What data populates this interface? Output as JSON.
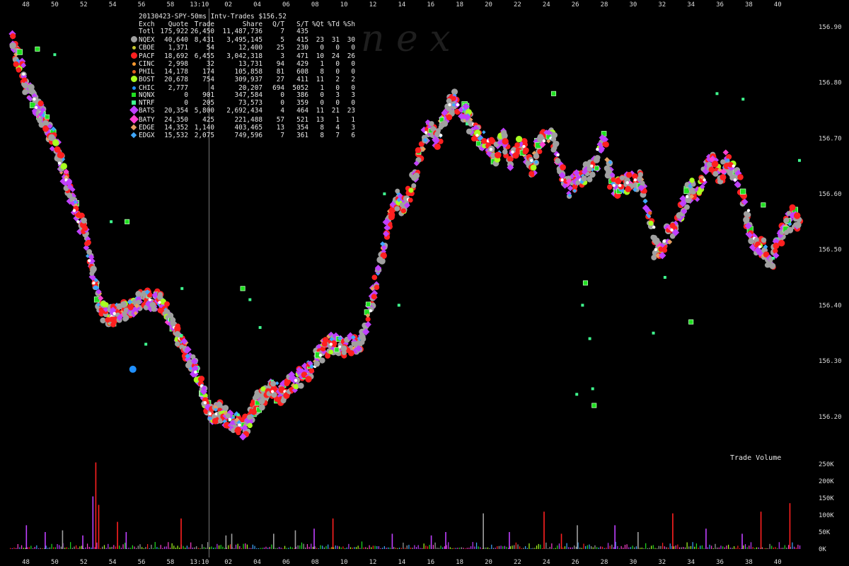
{
  "chart_data": {
    "type": "scatter",
    "title": "20130423-SPY-50ms Intv-Trades $156.52",
    "watermark": "n   e   x",
    "y_ticks": [
      "156.90",
      "156.80",
      "156.70",
      "156.60",
      "156.50",
      "156.40",
      "156.30",
      "156.20"
    ],
    "y_range": [
      156.135,
      156.91
    ],
    "x_ticks_top": [
      "48",
      "50",
      "52",
      "54",
      "56",
      "58",
      "13:10",
      "02",
      "04",
      "06",
      "08",
      "10",
      "12",
      "14",
      "16",
      "18",
      "20",
      "22",
      "24",
      "26",
      "28",
      "30",
      "32",
      "34",
      "36",
      "38",
      "40"
    ],
    "x_ticks_bottom": [
      "48",
      "50",
      "52",
      "54",
      "56",
      "58",
      "13:10",
      "02",
      "04",
      "06",
      "08",
      "10",
      "12",
      "14",
      "16",
      "18",
      "20",
      "22",
      "24",
      "26",
      "28",
      "30",
      "32",
      "34",
      "36",
      "38",
      "40"
    ],
    "x_unit": "minutes (13:00 = 60)",
    "x_range": [
      46.8,
      101.6
    ],
    "grid": "vertical line at 13:10 only",
    "volume_panel": {
      "title": "Trade Volume",
      "y_ticks": [
        "250K",
        "200K",
        "150K",
        "100K",
        "50K",
        "0K"
      ],
      "y_range": [
        0,
        250000
      ]
    },
    "price_path": [
      [
        47.0,
        156.88
      ],
      [
        47.3,
        156.85
      ],
      [
        47.7,
        156.83
      ],
      [
        48.0,
        156.8
      ],
      [
        48.3,
        156.78
      ],
      [
        48.7,
        156.76
      ],
      [
        49.0,
        156.75
      ],
      [
        49.3,
        156.73
      ],
      [
        49.7,
        156.71
      ],
      [
        50.0,
        156.69
      ],
      [
        50.3,
        156.67
      ],
      [
        50.6,
        156.64
      ],
      [
        51.0,
        156.61
      ],
      [
        51.3,
        156.58
      ],
      [
        51.6,
        156.56
      ],
      [
        52.0,
        156.54
      ],
      [
        52.3,
        156.5
      ],
      [
        52.6,
        156.46
      ],
      [
        52.9,
        156.42
      ],
      [
        53.3,
        156.39
      ],
      [
        53.7,
        156.38
      ],
      [
        54.0,
        156.38
      ],
      [
        54.4,
        156.39
      ],
      [
        54.8,
        156.39
      ],
      [
        55.2,
        156.39
      ],
      [
        55.6,
        156.4
      ],
      [
        56.0,
        156.41
      ],
      [
        56.4,
        156.41
      ],
      [
        56.8,
        156.41
      ],
      [
        57.2,
        156.41
      ],
      [
        57.6,
        156.4
      ],
      [
        58.0,
        156.37
      ],
      [
        58.4,
        156.35
      ],
      [
        58.8,
        156.33
      ],
      [
        59.2,
        156.31
      ],
      [
        59.6,
        156.29
      ],
      [
        60.0,
        156.27
      ],
      [
        60.3,
        156.24
      ],
      [
        60.6,
        156.21
      ],
      [
        61.0,
        156.2
      ],
      [
        61.4,
        156.21
      ],
      [
        61.8,
        156.2
      ],
      [
        62.2,
        156.19
      ],
      [
        62.6,
        156.19
      ],
      [
        63.0,
        156.18
      ],
      [
        63.4,
        156.19
      ],
      [
        63.8,
        156.22
      ],
      [
        64.2,
        156.23
      ],
      [
        64.6,
        156.24
      ],
      [
        65.0,
        156.25
      ],
      [
        65.5,
        156.24
      ],
      [
        66.0,
        156.25
      ],
      [
        66.5,
        156.26
      ],
      [
        67.0,
        156.27
      ],
      [
        67.5,
        156.28
      ],
      [
        68.0,
        156.3
      ],
      [
        68.5,
        156.32
      ],
      [
        69.0,
        156.33
      ],
      [
        69.5,
        156.33
      ],
      [
        70.0,
        156.32
      ],
      [
        70.5,
        156.33
      ],
      [
        71.0,
        156.32
      ],
      [
        71.5,
        156.36
      ],
      [
        72.0,
        156.42
      ],
      [
        72.5,
        156.47
      ],
      [
        72.9,
        156.53
      ],
      [
        73.3,
        156.57
      ],
      [
        73.7,
        156.59
      ],
      [
        74.1,
        156.58
      ],
      [
        74.5,
        156.6
      ],
      [
        75.0,
        156.64
      ],
      [
        75.5,
        156.7
      ],
      [
        76.0,
        156.72
      ],
      [
        76.4,
        156.69
      ],
      [
        76.8,
        156.72
      ],
      [
        77.2,
        156.75
      ],
      [
        77.6,
        156.77
      ],
      [
        78.0,
        156.75
      ],
      [
        78.5,
        156.74
      ],
      [
        79.0,
        156.71
      ],
      [
        79.5,
        156.7
      ],
      [
        80.0,
        156.69
      ],
      [
        80.5,
        156.67
      ],
      [
        81.0,
        156.7
      ],
      [
        81.5,
        156.66
      ],
      [
        82.0,
        156.69
      ],
      [
        82.5,
        156.68
      ],
      [
        83.0,
        156.64
      ],
      [
        83.5,
        156.69
      ],
      [
        84.0,
        156.7
      ],
      [
        84.5,
        156.7
      ],
      [
        85.0,
        156.64
      ],
      [
        85.5,
        156.61
      ],
      [
        86.0,
        156.62
      ],
      [
        86.5,
        156.63
      ],
      [
        87.0,
        156.64
      ],
      [
        87.5,
        156.66
      ],
      [
        88.0,
        156.7
      ],
      [
        88.5,
        156.62
      ],
      [
        89.0,
        156.61
      ],
      [
        89.5,
        156.62
      ],
      [
        90.0,
        156.62
      ],
      [
        90.5,
        156.63
      ],
      [
        91.0,
        156.58
      ],
      [
        91.5,
        156.5
      ],
      [
        92.0,
        156.5
      ],
      [
        92.5,
        156.53
      ],
      [
        93.0,
        156.54
      ],
      [
        93.5,
        156.58
      ],
      [
        94.0,
        156.61
      ],
      [
        94.5,
        156.6
      ],
      [
        95.0,
        156.65
      ],
      [
        95.5,
        156.66
      ],
      [
        96.0,
        156.63
      ],
      [
        96.5,
        156.66
      ],
      [
        97.0,
        156.64
      ],
      [
        97.5,
        156.61
      ],
      [
        98.0,
        156.53
      ],
      [
        98.5,
        156.51
      ],
      [
        99.0,
        156.5
      ],
      [
        99.5,
        156.47
      ],
      [
        100.0,
        156.52
      ],
      [
        100.5,
        156.54
      ],
      [
        101.0,
        156.56
      ],
      [
        101.6,
        156.54
      ]
    ],
    "isolated_points": [
      [
        48.8,
        156.86
      ],
      [
        50.0,
        156.85
      ],
      [
        53.9,
        156.55
      ],
      [
        55.0,
        156.55
      ],
      [
        56.3,
        156.33
      ],
      [
        58.8,
        156.43
      ],
      [
        63.0,
        156.43
      ],
      [
        63.5,
        156.41
      ],
      [
        64.2,
        156.36
      ],
      [
        69.5,
        156.32
      ],
      [
        72.8,
        156.6
      ],
      [
        73.8,
        156.4
      ],
      [
        84.5,
        156.78
      ],
      [
        86.1,
        156.24
      ],
      [
        86.5,
        156.4
      ],
      [
        86.7,
        156.44
      ],
      [
        87.0,
        156.34
      ],
      [
        87.2,
        156.25
      ],
      [
        87.3,
        156.22
      ],
      [
        91.4,
        156.35
      ],
      [
        92.2,
        156.45
      ],
      [
        94.0,
        156.37
      ],
      [
        95.8,
        156.78
      ],
      [
        97.6,
        156.77
      ],
      [
        99.0,
        156.58
      ],
      [
        101.5,
        156.66
      ]
    ],
    "exchanges": [
      {
        "exch": "Totl",
        "quote": "175,922",
        "trade": "26,450",
        "share": "11,487,736",
        "qt": "7",
        "st": "435",
        "xqt": "",
        "xtd": "",
        "xsh": "",
        "color": "",
        "marker": ""
      },
      {
        "exch": "NQEX",
        "quote": "40,640",
        "trade": "8,431",
        "share": "3,495,145",
        "qt": "5",
        "st": "415",
        "xqt": "23",
        "xtd": "31",
        "xsh": "30",
        "color": "#a0a0a0",
        "marker": "circle-lg"
      },
      {
        "exch": "CBOE",
        "quote": "1,371",
        "trade": "54",
        "share": "12,400",
        "qt": "25",
        "st": "230",
        "xqt": "0",
        "xtd": "0",
        "xsh": "0",
        "color": "#c8c830",
        "marker": "circle-sm"
      },
      {
        "exch": "PACF",
        "quote": "18,692",
        "trade": "6,455",
        "share": "3,042,318",
        "qt": "3",
        "st": "471",
        "xqt": "10",
        "xtd": "24",
        "xsh": "26",
        "color": "#ff2020",
        "marker": "circle-lg"
      },
      {
        "exch": "CINC",
        "quote": "2,998",
        "trade": "32",
        "share": "13,731",
        "qt": "94",
        "st": "429",
        "xqt": "1",
        "xtd": "0",
        "xsh": "0",
        "color": "#ff9a30",
        "marker": "circle-sm"
      },
      {
        "exch": "PHIL",
        "quote": "14,178",
        "trade": "174",
        "share": "105,858",
        "qt": "81",
        "st": "608",
        "xqt": "8",
        "xtd": "0",
        "xsh": "0",
        "color": "#e06020",
        "marker": "circle-sm"
      },
      {
        "exch": "BOST",
        "quote": "20,678",
        "trade": "754",
        "share": "309,937",
        "qt": "27",
        "st": "411",
        "xqt": "11",
        "xtd": "2",
        "xsh": "2",
        "color": "#a8ff20",
        "marker": "circle-lg"
      },
      {
        "exch": "CHIC",
        "quote": "2,777",
        "trade": "4",
        "share": "20,207",
        "qt": "694",
        "st": "5052",
        "xqt": "1",
        "xtd": "0",
        "xsh": "0",
        "color": "#2090ff",
        "marker": "circle-sm"
      },
      {
        "exch": "NQNX",
        "quote": "0",
        "trade": "901",
        "share": "347,584",
        "qt": "0",
        "st": "386",
        "xqt": "0",
        "xtd": "3",
        "xsh": "3",
        "color": "#20e020",
        "marker": "square"
      },
      {
        "exch": "NTRF",
        "quote": "0",
        "trade": "205",
        "share": "73,573",
        "qt": "0",
        "st": "359",
        "xqt": "0",
        "xtd": "0",
        "xsh": "0",
        "color": "#40ff90",
        "marker": "square-sm"
      },
      {
        "exch": "BATS",
        "quote": "20,354",
        "trade": "5,800",
        "share": "2,692,434",
        "qt": "4",
        "st": "464",
        "xqt": "11",
        "xtd": "21",
        "xsh": "23",
        "color": "#c040ff",
        "marker": "diamond-lg"
      },
      {
        "exch": "BATY",
        "quote": "24,350",
        "trade": "425",
        "share": "221,488",
        "qt": "57",
        "st": "521",
        "xqt": "13",
        "xtd": "1",
        "xsh": "1",
        "color": "#ff40d0",
        "marker": "diamond-lg"
      },
      {
        "exch": "EDGE",
        "quote": "14,352",
        "trade": "1,140",
        "share": "403,465",
        "qt": "13",
        "st": "354",
        "xqt": "8",
        "xtd": "4",
        "xsh": "3",
        "color": "#e8a060",
        "marker": "diamond"
      },
      {
        "exch": "EDGX",
        "quote": "15,532",
        "trade": "2,075",
        "share": "749,596",
        "qt": "7",
        "st": "361",
        "xqt": "8",
        "xtd": "7",
        "xsh": "6",
        "color": "#40a8ff",
        "marker": "diamond"
      }
    ],
    "columns": {
      "exch": "Exch",
      "quote": "Quote",
      "trade": "Trade",
      "share": "Share",
      "qt": "Q/T",
      "st": "S/T",
      "xqt": "%Qt",
      "xtd": "%Td",
      "xsh": "%Sh"
    },
    "volume_spikes": [
      [
        48.0,
        70000
      ],
      [
        49.3,
        50000
      ],
      [
        50.5,
        55000
      ],
      [
        51.9,
        40000
      ],
      [
        52.6,
        155000
      ],
      [
        52.8,
        255000
      ],
      [
        53.0,
        130000
      ],
      [
        54.3,
        80000
      ],
      [
        54.9,
        50000
      ],
      [
        58.7,
        90000
      ],
      [
        61.8,
        40000
      ],
      [
        62.2,
        45000
      ],
      [
        65.1,
        45000
      ],
      [
        66.6,
        55000
      ],
      [
        67.9,
        60000
      ],
      [
        69.2,
        90000
      ],
      [
        73.3,
        45000
      ],
      [
        76.0,
        40000
      ],
      [
        77.0,
        50000
      ],
      [
        79.6,
        105000
      ],
      [
        81.4,
        50000
      ],
      [
        83.8,
        110000
      ],
      [
        85.0,
        45000
      ],
      [
        86.1,
        70000
      ],
      [
        88.7,
        70000
      ],
      [
        90.3,
        50000
      ],
      [
        92.7,
        105000
      ],
      [
        95.0,
        60000
      ],
      [
        97.5,
        45000
      ],
      [
        98.8,
        110000
      ],
      [
        100.8,
        135000
      ]
    ]
  }
}
